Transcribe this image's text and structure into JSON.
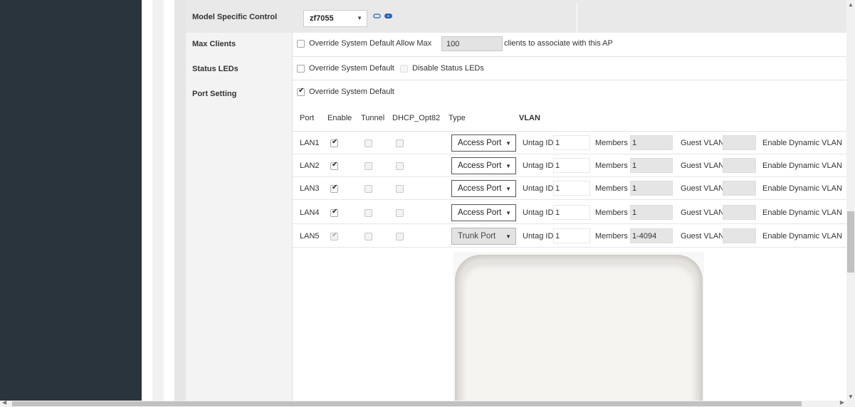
{
  "rows": {
    "model": {
      "label": "Model Specific Control",
      "value": "zf7055"
    },
    "max_clients": {
      "label": "Max Clients",
      "override_label": "Override System Default",
      "allow_max_label": "Allow Max",
      "value": "100",
      "suffix": "clients to associate with this AP"
    },
    "status_leds": {
      "label": "Status LEDs",
      "override_label": "Override System Default",
      "disable_label": "Disable Status LEDs"
    },
    "port_setting": {
      "label": "Port Setting",
      "override_label": "Override System Default",
      "headers": {
        "port": "Port",
        "enable": "Enable",
        "tunnel": "Tunnel",
        "dhcp": "DHCP_Opt82",
        "type": "Type",
        "vlan": "VLAN"
      },
      "untag_label": "Untag ID",
      "members_label": "Members",
      "guest_label": "Guest VLAN",
      "dynamic_label": "Enable Dynamic VLAN",
      "ports": [
        {
          "name": "LAN1",
          "type": "Access Port",
          "untag": "1",
          "members": "1"
        },
        {
          "name": "LAN2",
          "type": "Access Port",
          "untag": "1",
          "members": "1"
        },
        {
          "name": "LAN3",
          "type": "Access Port",
          "untag": "1",
          "members": "1"
        },
        {
          "name": "LAN4",
          "type": "Access Port",
          "untag": "1",
          "members": "1"
        },
        {
          "name": "LAN5",
          "type": "Trunk Port",
          "untag": "1",
          "members": "1-4094"
        }
      ]
    }
  },
  "icons": {
    "caret": "▼",
    "scroll_up": "▲",
    "scroll_down": "▼",
    "scroll_left": "◀",
    "scroll_right": "▶"
  },
  "colors": {
    "sidebar": "#2a343d",
    "label_bg": "#f3f3f3",
    "model_row_bg": "#e9e9e9",
    "link_icon": "#2e62b4"
  }
}
